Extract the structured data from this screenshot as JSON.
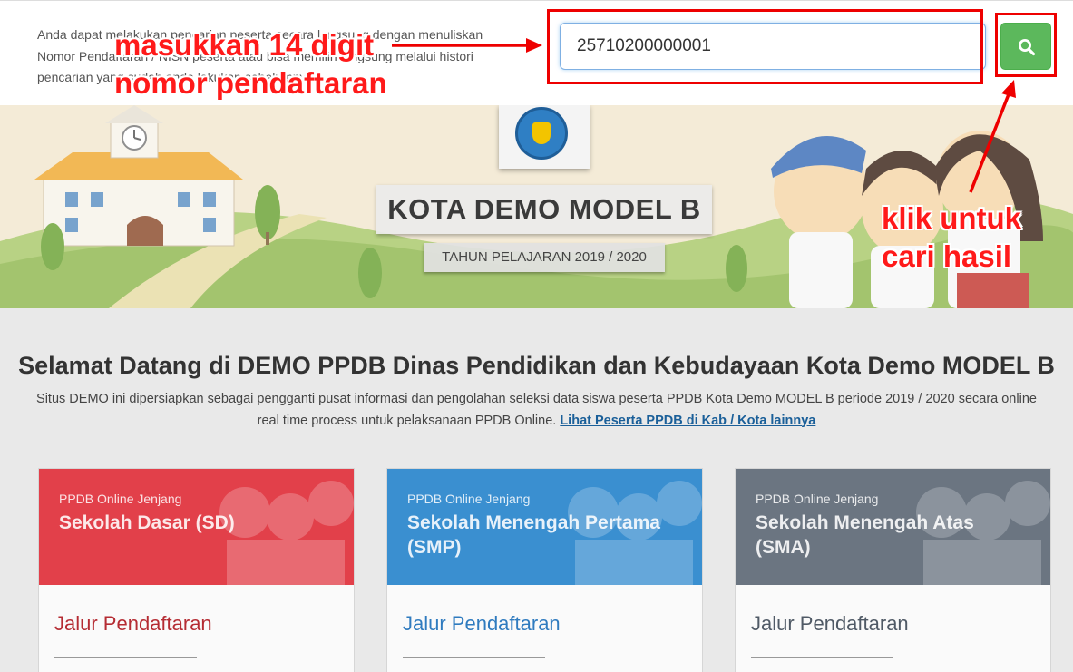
{
  "search": {
    "intro_text": "Anda dapat melakukan pencarian peserta secara langsung dengan menuliskan Nomor Pendaftaran / NISN peserta atau bisa memilih langsung melalui histori pencarian yang sudah anda lakukan sebelumnya.",
    "value": "25710200000001",
    "button_icon": "search-icon"
  },
  "hero": {
    "title": "KOTA DEMO MODEL B",
    "subtitle": "TAHUN PELAJARAN 2019 / 2020",
    "logo_icon": "tut-wuri-handayani-emblem"
  },
  "welcome": {
    "heading": "Selamat Datang di DEMO PPDB Dinas Pendidikan dan Kebudayaan Kota Demo MODEL B",
    "description": "Situs DEMO ini dipersiapkan sebagai pengganti pusat informasi dan pengolahan seleksi data siswa peserta PPDB Kota Demo MODEL B periode 2019 / 2020 secara online real time process untuk pelaksanaan PPDB Online.",
    "link_text": "Lihat Peserta PPDB di Kab / Kota lainnya"
  },
  "cards": [
    {
      "kicker": "PPDB Online Jenjang",
      "title": "Sekolah Dasar (SD)",
      "footer_title": "Jalur Pendaftaran",
      "color": "#e2404a"
    },
    {
      "kicker": "PPDB Online Jenjang",
      "title": "Sekolah Menengah Pertama (SMP)",
      "footer_title": "Jalur Pendaftaran",
      "color": "#3a8fd0"
    },
    {
      "kicker": "PPDB Online Jenjang",
      "title": "Sekolah Menengah Atas (SMA)",
      "footer_title": "Jalur Pendaftaran",
      "color": "#6b7581"
    }
  ],
  "annotations": {
    "input_hint_line1": "masukkan 14 digit",
    "input_hint_line2": "nomor pendaftaran",
    "button_hint_line1": "klik untuk",
    "button_hint_line2": "cari hasil",
    "color": "#ee0000"
  }
}
